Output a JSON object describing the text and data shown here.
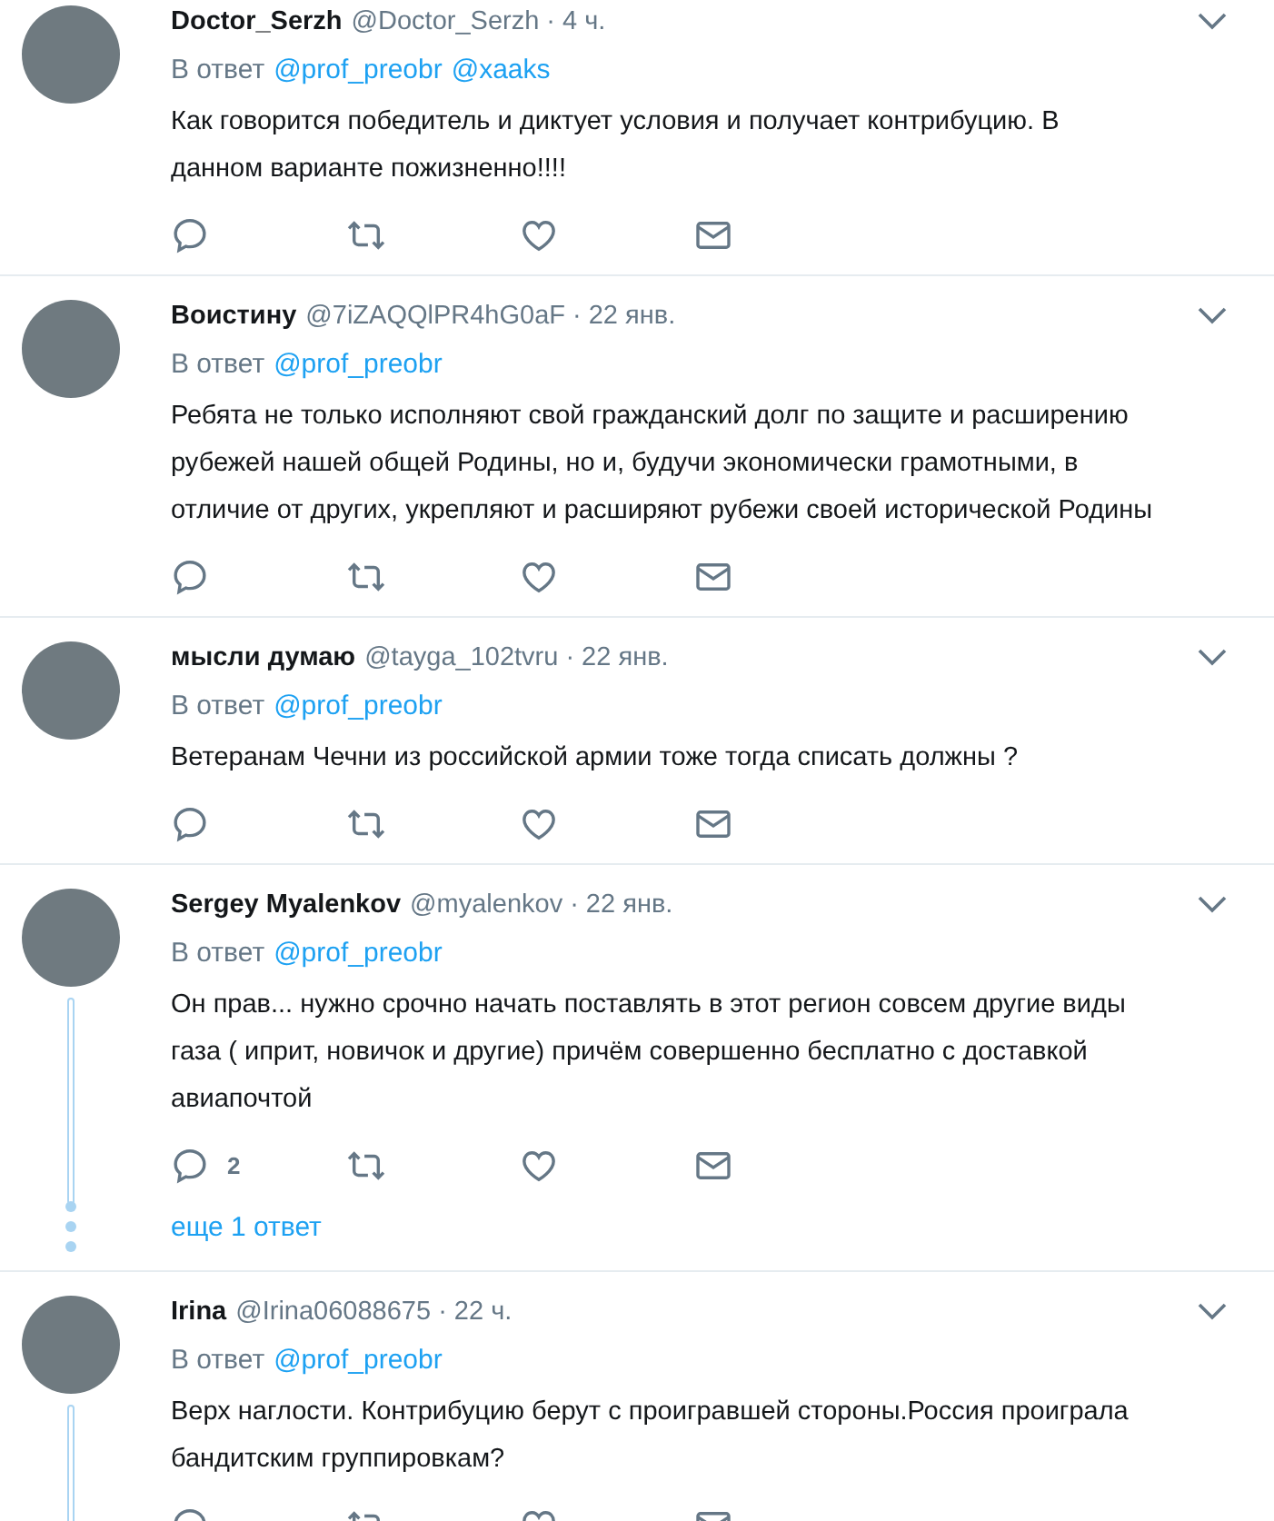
{
  "tweets": [
    {
      "name": "Doctor_Serzh",
      "handle": "@Doctor_Serzh",
      "time": "· 4 ч.",
      "reply_label": "В ответ",
      "reply_to": [
        "@prof_preobr",
        "@xaaks"
      ],
      "text": "Как говорится победитель и диктует условия и получает контрибуцию. В данном варианте пожизненно!!!!",
      "thread": false
    },
    {
      "name": "Воистину",
      "handle": "@7iZAQQlPR4hG0aF",
      "time": "· 22 янв.",
      "reply_label": "В ответ",
      "reply_to": [
        "@prof_preobr"
      ],
      "text": "Ребята не только исполняют свой гражданский долг по защите и расширению рубежей нашей общей Родины, но и, будучи экономически грамотными, в отличие от других, укрепляют и расширяют рубежи своей исторической Родины",
      "thread": false
    },
    {
      "name": "мысли думаю",
      "handle": "@tayga_102tvru",
      "time": "· 22 янв.",
      "reply_label": "В ответ",
      "reply_to": [
        "@prof_preobr"
      ],
      "text": "Ветеранам Чечни из российской армии тоже тогда списать должны ?",
      "thread": false
    },
    {
      "name": "Sergey Myalenkov",
      "handle": "@myalenkov",
      "time": "· 22 янв.",
      "reply_label": "В ответ",
      "reply_to": [
        "@prof_preobr"
      ],
      "text": "Он прав... нужно срочно начать поставлять в этот регион совсем другие виды газа ( иприт, новичок и другие) причём совершенно бесплатно с доставкой авиапочтой",
      "reply_count": "2",
      "thread": true,
      "more_replies": "еще 1 ответ"
    },
    {
      "name": "Irina",
      "handle": "@Irina06088675",
      "time": "· 22 ч.",
      "reply_label": "В ответ",
      "reply_to": [
        "@prof_preobr"
      ],
      "text": "Верх наглости. Контрибуцию берут с проигравшей стороны.Россия проиграла бандитским группировкам?",
      "thread": true
    }
  ]
}
